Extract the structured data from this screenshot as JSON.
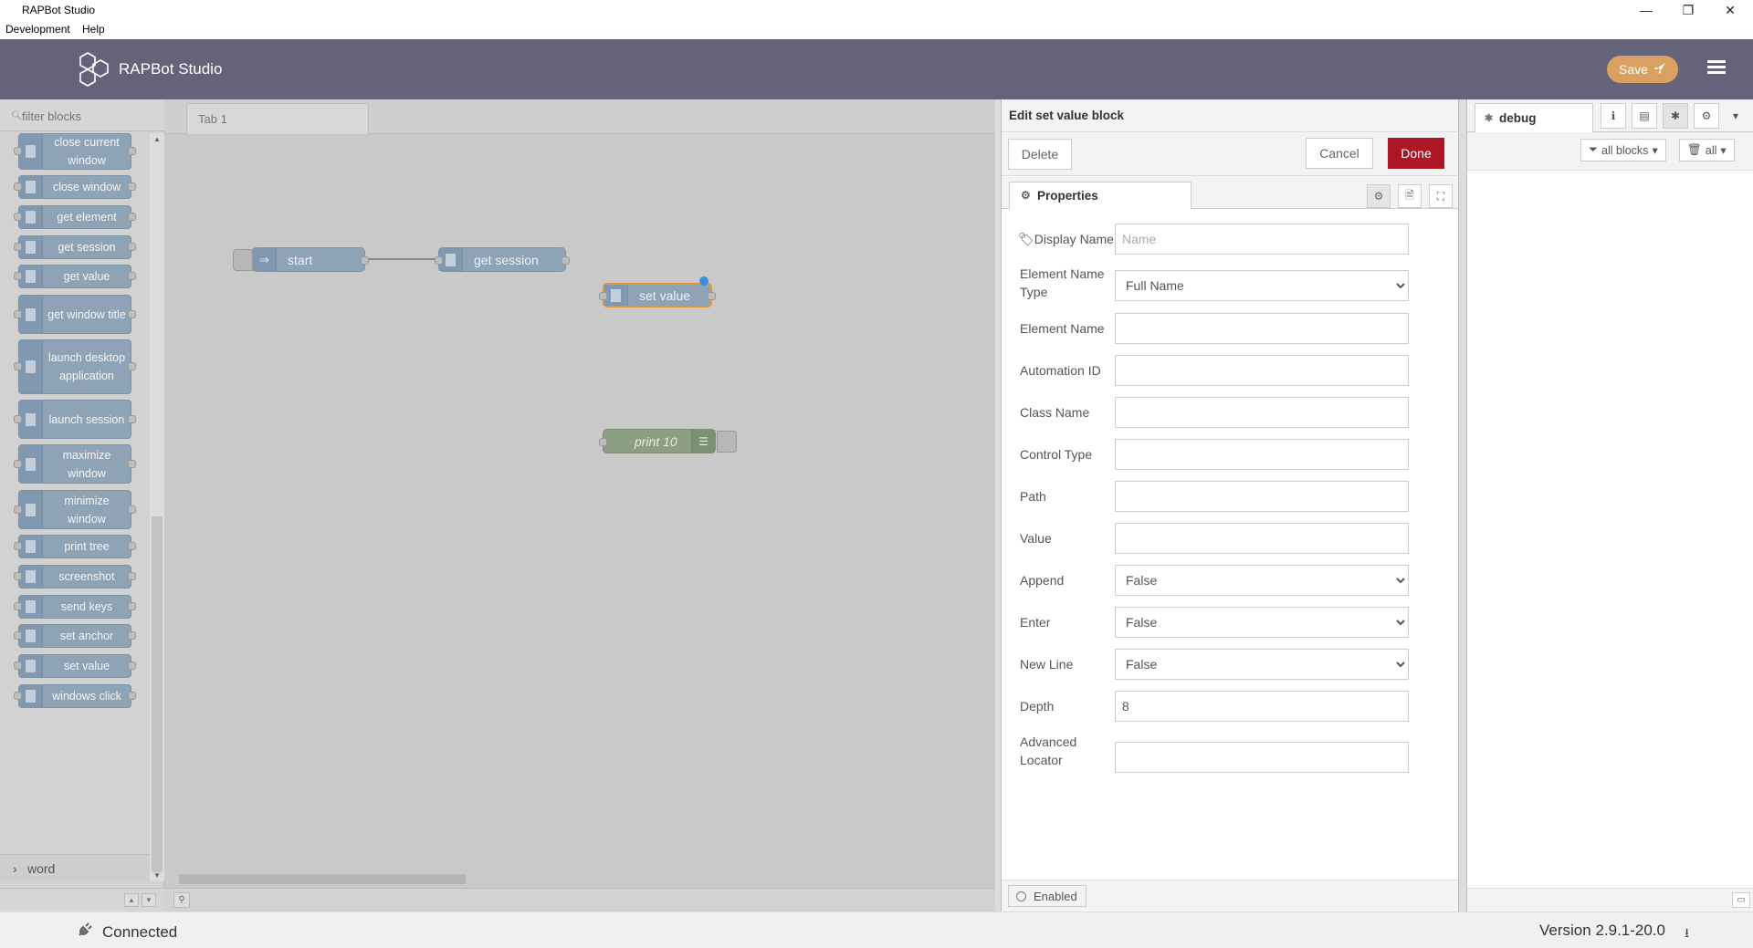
{
  "window": {
    "title": "RAPBot Studio",
    "menu": [
      "Development",
      "Help"
    ],
    "controls": {
      "minimize": "—",
      "restore": "❐",
      "close": "✕"
    }
  },
  "header": {
    "brand": "RAPBot Studio",
    "save_label": "Save",
    "accent_color": "#65637a",
    "save_color": "#d9a060"
  },
  "palette": {
    "filter_placeholder": "filter blocks",
    "blocks": [
      {
        "label": "close current window"
      },
      {
        "label": "close window"
      },
      {
        "label": "get element"
      },
      {
        "label": "get session"
      },
      {
        "label": "get value"
      },
      {
        "label": "get window title"
      },
      {
        "label": "launch desktop application"
      },
      {
        "label": "launch session"
      },
      {
        "label": "maximize window"
      },
      {
        "label": "minimize window"
      },
      {
        "label": "print tree"
      },
      {
        "label": "screenshot"
      },
      {
        "label": "send keys"
      },
      {
        "label": "set anchor"
      },
      {
        "label": "set value"
      },
      {
        "label": "windows click"
      }
    ],
    "category": "word",
    "category_chevron": "›"
  },
  "workspace": {
    "tab": "Tab 1",
    "nodes": [
      {
        "label": "start"
      },
      {
        "label": "get session"
      },
      {
        "label": "set value"
      },
      {
        "label": "print 10"
      }
    ]
  },
  "editor": {
    "title": "Edit set value block",
    "delete_label": "Delete",
    "cancel_label": "Cancel",
    "done_label": "Done",
    "done_color": "#ad1625",
    "tab_label": "Properties",
    "fields": {
      "display_name": {
        "label": "Display Name",
        "value": "",
        "placeholder": "Name"
      },
      "element_name_type": {
        "label": "Element Name Type",
        "value": "Full Name"
      },
      "element_name": {
        "label": "Element Name",
        "value": ""
      },
      "automation_id": {
        "label": "Automation ID",
        "value": ""
      },
      "class_name": {
        "label": "Class Name",
        "value": ""
      },
      "control_type": {
        "label": "Control Type",
        "value": ""
      },
      "path": {
        "label": "Path",
        "value": ""
      },
      "value": {
        "label": "Value",
        "value": ""
      },
      "append": {
        "label": "Append",
        "value": "False"
      },
      "enter": {
        "label": "Enter",
        "value": "False"
      },
      "new_line": {
        "label": "New Line",
        "value": "False"
      },
      "depth": {
        "label": "Depth",
        "value": "8"
      },
      "advanced_locator": {
        "label": "Advanced Locator",
        "value": ""
      }
    },
    "enabled_label": "Enabled"
  },
  "sidebar": {
    "tab_label": "debug",
    "filter_label": "all blocks",
    "clear_label": "all"
  },
  "status": {
    "connection": "Connected",
    "version": "Version 2.9.1-20.0"
  }
}
